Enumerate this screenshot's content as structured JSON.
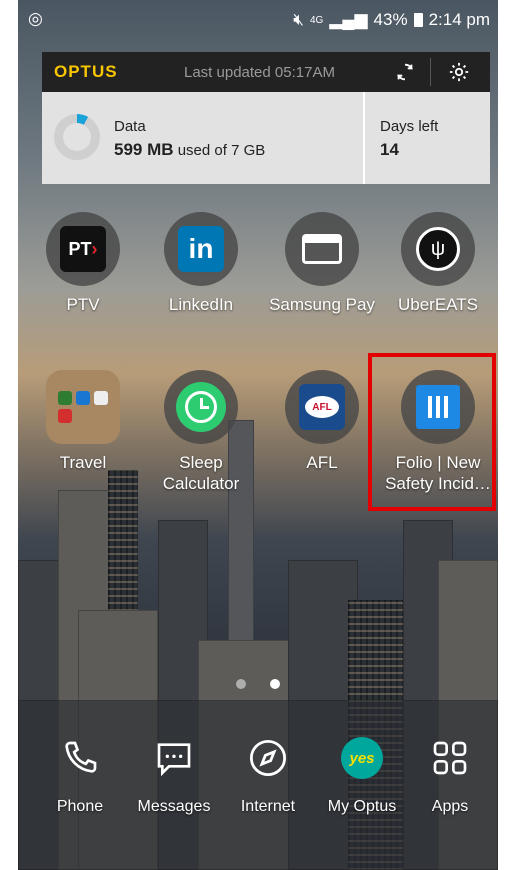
{
  "status_bar": {
    "network": "4G",
    "battery": "43%",
    "time": "2:14 pm"
  },
  "widget": {
    "brand": "OPTUS",
    "last_updated": "Last updated 05:17AM",
    "data_label": "Data",
    "data_used": "599 MB",
    "data_suffix": "used of 7 GB",
    "data_fraction": 0.08,
    "days_label": "Days left",
    "days_value": "14"
  },
  "apps": [
    {
      "label": "PTV",
      "icon": "ptv-icon"
    },
    {
      "label": "LinkedIn",
      "icon": "linkedin-icon"
    },
    {
      "label": "Samsung Pay",
      "icon": "samsung-pay-icon"
    },
    {
      "label": "UberEATS",
      "icon": "ubereats-icon"
    },
    {
      "label": "Travel",
      "icon": "folder-icon"
    },
    {
      "label": "Sleep Calculator",
      "icon": "sleep-calculator-icon"
    },
    {
      "label": "AFL",
      "icon": "afl-icon"
    },
    {
      "label": "Folio | New Safety Incid…",
      "icon": "folio-icon"
    }
  ],
  "dock": [
    {
      "label": "Phone",
      "icon": "phone-icon"
    },
    {
      "label": "Messages",
      "icon": "messages-icon"
    },
    {
      "label": "Internet",
      "icon": "compass-icon"
    },
    {
      "label": "My Optus",
      "icon": "yes-icon"
    },
    {
      "label": "Apps",
      "icon": "apps-grid-icon"
    }
  ],
  "colors": {
    "optus_yellow": "#f7c600",
    "highlight_red": "#e20000",
    "linkedin_blue": "#0077b5",
    "folio_blue": "#1e88e5"
  }
}
